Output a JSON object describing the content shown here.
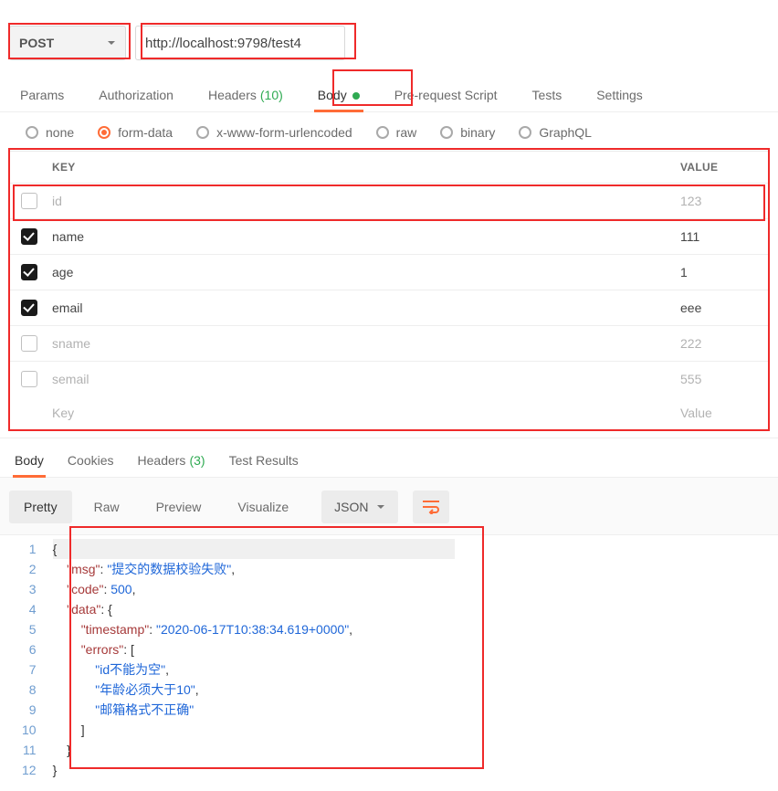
{
  "method": "POST",
  "url": "http://localhost:9798/test4",
  "request_tabs": {
    "params": "Params",
    "auth": "Authorization",
    "headers": "Headers",
    "headers_count": "(10)",
    "body": "Body",
    "prerequest": "Pre-request Script",
    "tests": "Tests",
    "settings": "Settings"
  },
  "body_types": {
    "none": "none",
    "formdata": "form-data",
    "xwww": "x-www-form-urlencoded",
    "raw": "raw",
    "binary": "binary",
    "graphql": "GraphQL",
    "selected": "formdata"
  },
  "formdata": {
    "col_key": "KEY",
    "col_value": "VALUE",
    "rows": [
      {
        "checked": false,
        "key": "id",
        "value": "123",
        "disabled": true
      },
      {
        "checked": true,
        "key": "name",
        "value": "111",
        "disabled": false
      },
      {
        "checked": true,
        "key": "age",
        "value": "1",
        "disabled": false
      },
      {
        "checked": true,
        "key": "email",
        "value": "eee",
        "disabled": false
      },
      {
        "checked": false,
        "key": "sname",
        "value": "222",
        "disabled": true
      },
      {
        "checked": false,
        "key": "semail",
        "value": "555",
        "disabled": true
      }
    ],
    "placeholder_key": "Key",
    "placeholder_value": "Value"
  },
  "response_tabs": {
    "body": "Body",
    "cookies": "Cookies",
    "headers": "Headers",
    "headers_count": "(3)",
    "testresults": "Test Results"
  },
  "response_toolbar": {
    "pretty": "Pretty",
    "raw": "Raw",
    "preview": "Preview",
    "visualize": "Visualize",
    "format": "JSON"
  },
  "response_json": {
    "msg": "提交的数据校验失败",
    "code": 500,
    "data": {
      "timestamp": "2020-06-17T10:38:34.619+0000",
      "errors": [
        "id不能为空",
        "年龄必须大于10",
        "邮箱格式不正确"
      ]
    }
  }
}
